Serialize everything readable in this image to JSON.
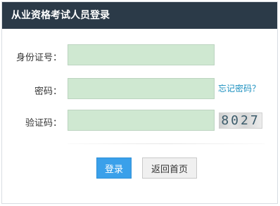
{
  "header": {
    "title": "从业资格考试人员登录"
  },
  "form": {
    "id_label": "身份证号：",
    "id_value": "",
    "password_label": "密码：",
    "password_value": "",
    "forgot_link": "忘记密码？",
    "captcha_label": "验证码：",
    "captcha_value": "",
    "captcha_text": "8027"
  },
  "buttons": {
    "login": "登录",
    "home": "返回首页"
  },
  "colors": {
    "header_bg": "#2b3a48",
    "input_bg": "#cfe8d1",
    "link": "#1a8fbf",
    "primary_button": "#3aa0ea"
  }
}
